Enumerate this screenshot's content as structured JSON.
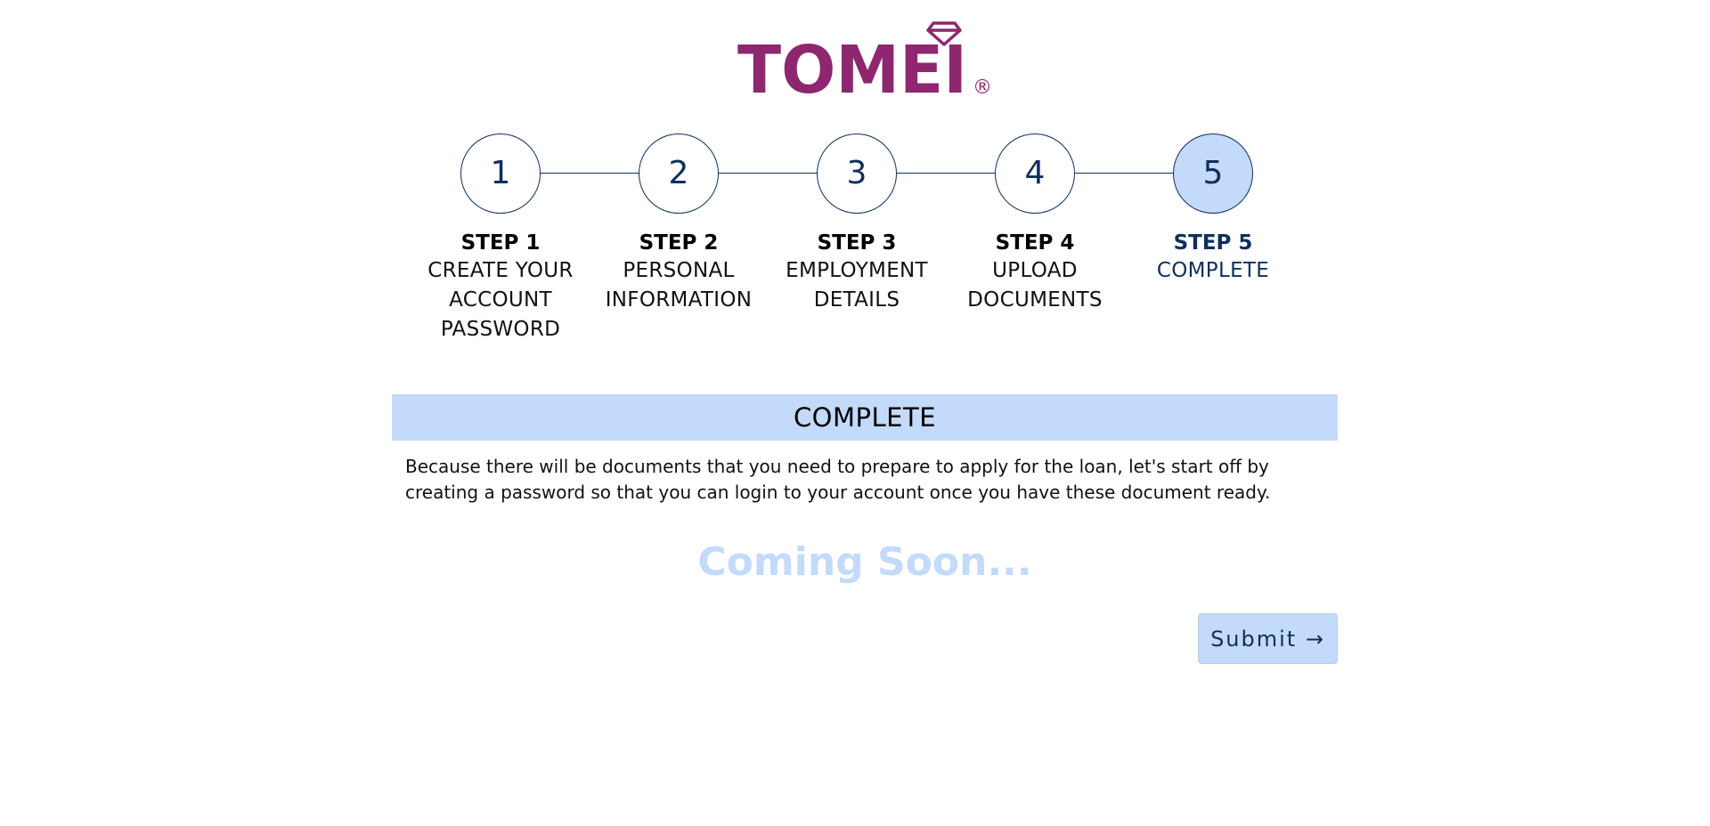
{
  "brand": {
    "name": "TOMEI",
    "registered_mark": "®",
    "color": "#8e2770"
  },
  "stepper": {
    "steps": [
      {
        "number": "1",
        "title": "STEP 1",
        "desc_lines": [
          "CREATE YOUR",
          "ACCOUNT",
          "PASSWORD"
        ],
        "active": false
      },
      {
        "number": "2",
        "title": "STEP 2",
        "desc_lines": [
          "PERSONAL",
          "INFORMATION"
        ],
        "active": false
      },
      {
        "number": "3",
        "title": "STEP 3",
        "desc_lines": [
          "EMPLOYMENT",
          "DETAILS"
        ],
        "active": false
      },
      {
        "number": "4",
        "title": "STEP 4",
        "desc_lines": [
          "UPLOAD",
          "DOCUMENTS"
        ],
        "active": false
      },
      {
        "number": "5",
        "title": "STEP 5",
        "desc_lines": [
          "COMPLETE"
        ],
        "active": true
      }
    ],
    "active_color": "#c3dafa",
    "line_color": "#0f2f5c"
  },
  "section": {
    "header": "COMPLETE",
    "description": "Because there will be documents that you need to prepare to apply for the loan, let's start off by creating a password so that you can login to your account once you have these document ready.",
    "coming_soon": "Coming Soon..."
  },
  "actions": {
    "submit_label": "Submit →"
  }
}
